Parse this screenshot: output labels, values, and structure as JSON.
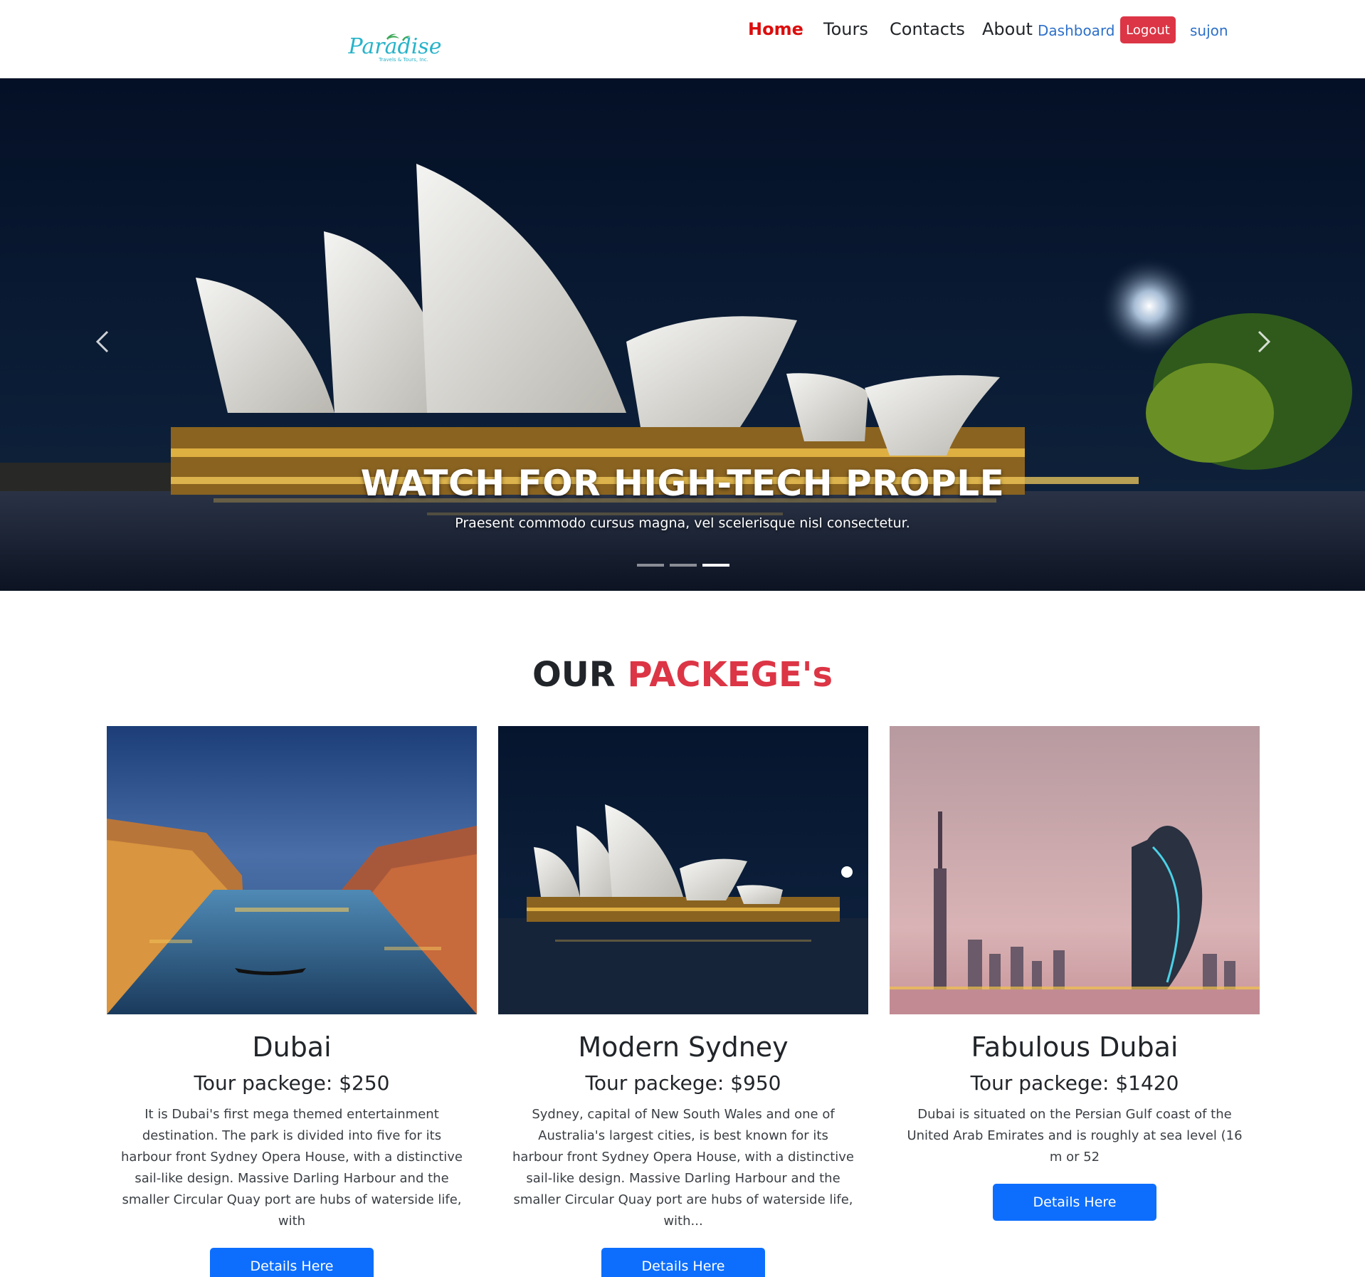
{
  "brand": {
    "logo_text": "Paradise",
    "logo_tagline": "Travels & Tours, Inc."
  },
  "nav": {
    "home": "Home",
    "tours": "Tours",
    "contacts": "Contacts",
    "about": "About",
    "dashboard": "Dashboard",
    "logout": "Logout",
    "user": "sujon"
  },
  "hero": {
    "title": "WATCH FOR HIGH-TECH PROPLE",
    "subtitle": "Praesent commodo cursus magna, vel scelerisque nisl consectetur.",
    "active_slide": 3,
    "slide_count": 3
  },
  "packages": {
    "heading_plain": "OUR",
    "heading_accent": "PACKEGE's",
    "items": [
      {
        "title": "Dubai",
        "price": "Tour packege: $250",
        "description": "It is Dubai's first mega themed entertainment destination. The park is divided into five for its harbour front Sydney Opera House, with a distinctive sail-like design. Massive Darling Harbour and the smaller Circular Quay port are hubs of waterside life, with",
        "button": "Details Here"
      },
      {
        "title": "Modern Sydney",
        "price": "Tour packege: $950",
        "description": "Sydney, capital of New South Wales and one of Australia's largest cities, is best known for its harbour front Sydney Opera House, with a distinctive sail-like design. Massive Darling Harbour and the smaller Circular Quay port are hubs of waterside life, with...",
        "button": "Details Here"
      },
      {
        "title": "Fabulous Dubai",
        "price": "Tour packege: $1420",
        "description": "Dubai is situated on the Persian Gulf coast of the United Arab Emirates and is roughly at sea level (16 m or 52",
        "button": "Details Here"
      }
    ]
  },
  "colors": {
    "accent_red": "#dc3545",
    "nav_active": "#dc0d0d",
    "link_blue": "#2c6fc9",
    "primary_button": "#0d6efd"
  }
}
